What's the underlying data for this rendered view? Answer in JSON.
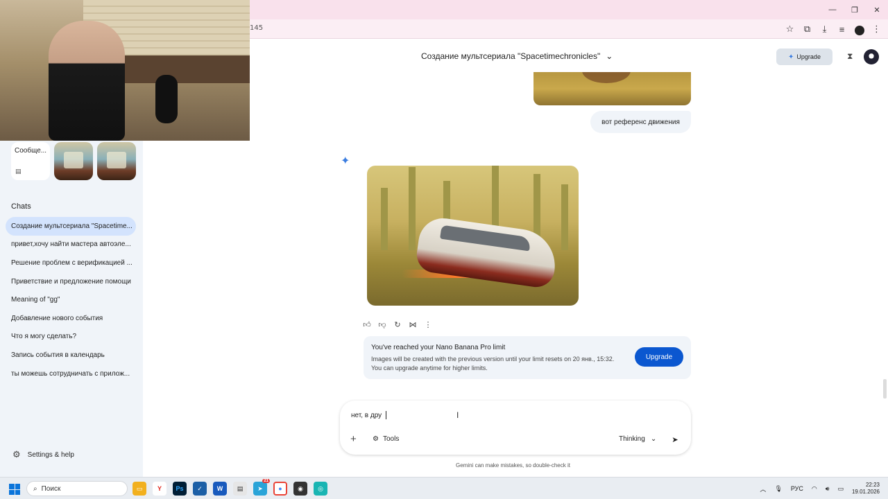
{
  "browser": {
    "url": "145",
    "controls": {
      "minimize": "—",
      "restore": "❐",
      "close": "✕"
    },
    "toolbar_icons": [
      "star-icon",
      "extensions-icon",
      "download-icon",
      "playlist-icon",
      "profile-icon",
      "menu-icon"
    ]
  },
  "sidebar": {
    "recent_card_title": "Сообще...",
    "chats_heading": "Chats",
    "chats": [
      "Создание мультсериала \"Spacetime...",
      "привет,хочу найти мастера автоэле...",
      "Решение проблем с верификацией ...",
      "Приветствие и предложение помощи",
      "Meaning of \"gg\"",
      "Добавление нового события",
      "Что я могу сделать?",
      "Запись события в календарь",
      "ты можешь сотрудничать с прилож..."
    ],
    "active_index": 0,
    "settings_label": "Settings & help"
  },
  "header": {
    "title": "Создание мультсериала \"Spacetimechronicles\"",
    "upgrade_label": "Upgrade"
  },
  "conversation": {
    "user_message": "вот референс движения",
    "limit": {
      "heading": "You've reached your Nano Banana Pro limit",
      "line1": "Images will be created with the previous version until your limit resets on 20 янв., 15:32.",
      "line2": "You can upgrade anytime for higher limits.",
      "button": "Upgrade"
    }
  },
  "composer": {
    "text": "нет, в дру",
    "tools_label": "Tools",
    "mode_label": "Thinking",
    "disclaimer": "Gemini can make mistakes, so double-check it"
  },
  "taskbar": {
    "search_placeholder": "Поиск",
    "lang": "РУС",
    "time": "22:23",
    "date": "19.01.2026",
    "badge_count": "21"
  },
  "colors": {
    "accent": "#0b57d0",
    "sidebar_bg": "#f0f4f9",
    "titlebar_bg": "#f9e1ec",
    "active_chat_bg": "#d3e3fd"
  }
}
